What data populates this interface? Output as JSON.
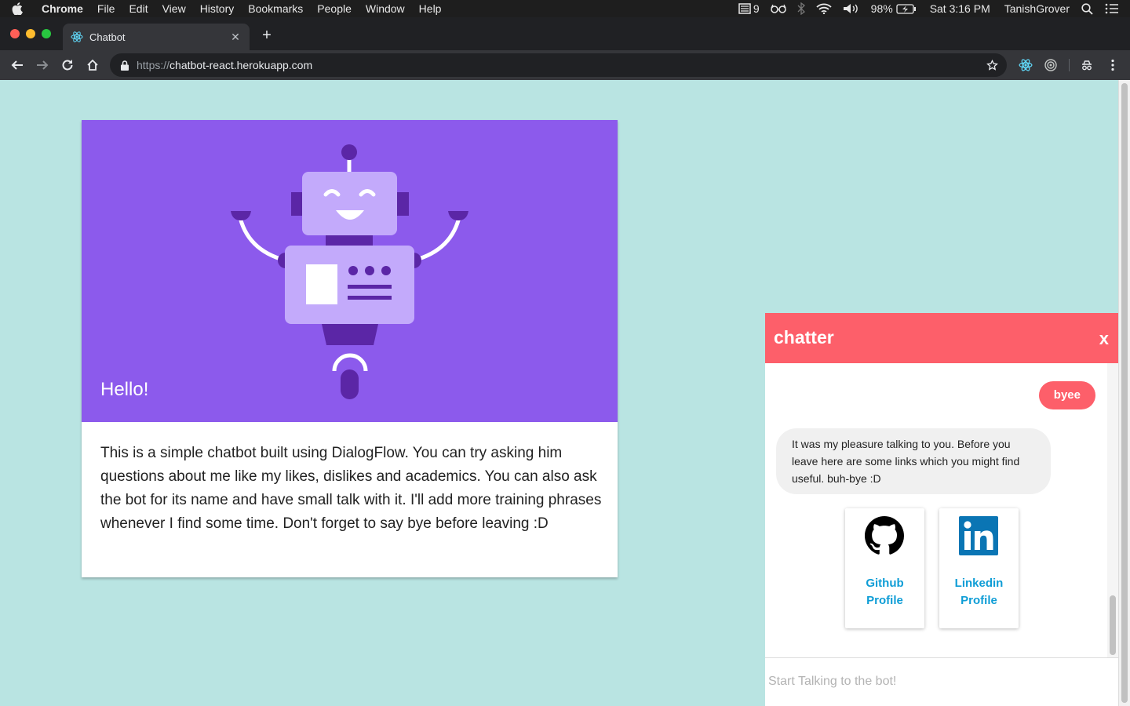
{
  "menubar": {
    "app": "Chrome",
    "items": [
      "File",
      "Edit",
      "View",
      "History",
      "Bookmarks",
      "People",
      "Window",
      "Help"
    ],
    "notif_count": "9",
    "battery": "98%",
    "clock": "Sat 3:16 PM",
    "user": "TanishGrover"
  },
  "browser": {
    "tab_title": "Chatbot",
    "url_scheme": "https://",
    "url_host": "chatbot-react.herokuapp.com"
  },
  "card": {
    "title": "Hello!",
    "text": "This is a simple chatbot built using DialogFlow. You can try asking him questions about me like my likes, dislikes and academics. You can also ask the bot for its name and have small talk with it. I'll add more training phrases whenever I find some time. Don't forget to say bye before leaving :D"
  },
  "chat": {
    "title": "chatter",
    "close_label": "x",
    "messages": [
      {
        "from": "user",
        "text": "byee"
      },
      {
        "from": "bot",
        "text": "It was my pleasure talking to you. Before you leave here are some links which you might find useful. buh-bye :D"
      }
    ],
    "links": [
      {
        "icon": "github-icon",
        "line1": "Github",
        "line2": "Profile"
      },
      {
        "icon": "linkedin-icon",
        "line1": "Linkedin",
        "line2": "Profile"
      }
    ],
    "input_placeholder": "Start Talking to the bot!"
  },
  "colors": {
    "page_bg": "#b9e4e2",
    "card_media_bg": "#8c5aec",
    "chat_accent": "#fd5f6a",
    "link_color": "#0e9dd6"
  }
}
